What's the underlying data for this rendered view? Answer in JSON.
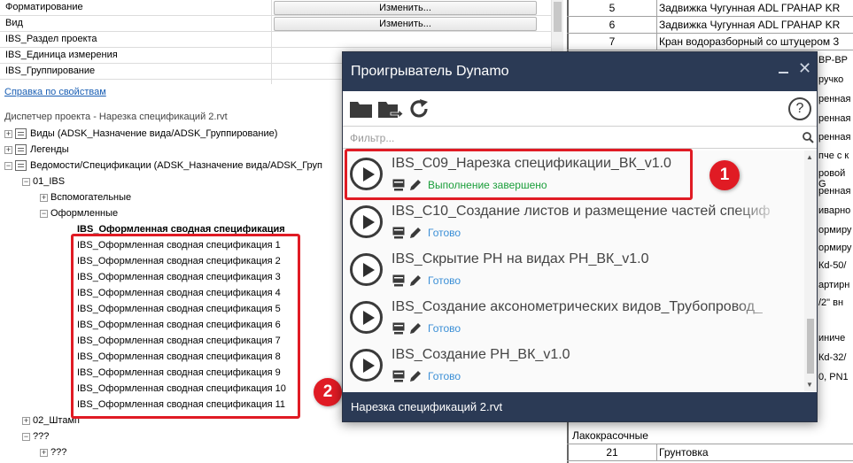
{
  "properties": {
    "rows": [
      {
        "name": "Форматирование",
        "button": "Изменить..."
      },
      {
        "name": "Вид",
        "button": "Изменить..."
      },
      {
        "name": "IBS_Раздел проекта",
        "button": ""
      },
      {
        "name": "IBS_Единица измерения",
        "button": ""
      },
      {
        "name": "IBS_Группирование",
        "button": ""
      }
    ],
    "help_link": "Справка по свойствам"
  },
  "browser": {
    "title": "Диспетчер проекта - Нарезка спецификаций 2.rvt",
    "views": "Виды (ADSK_Назначение вида/ADSK_Группирование)",
    "legends": "Легенды",
    "schedules": "Ведомости/Спецификации (ADSK_Назначение вида/ADSK_Груп",
    "group_01": "01_IBS",
    "aux": "Вспомогательные",
    "formatted": "Оформленные",
    "summary": "IBS_Оформленная сводная спецификация",
    "items": [
      "IBS_Оформленная сводная спецификация 1",
      "IBS_Оформленная сводная спецификация 2",
      "IBS_Оформленная сводная спецификация 3",
      "IBS_Оформленная сводная спецификация 4",
      "IBS_Оформленная сводная спецификация 5",
      "IBS_Оформленная сводная спецификация 6",
      "IBS_Оформленная сводная спецификация 7",
      "IBS_Оформленная сводная спецификация 8",
      "IBS_Оформленная сводная спецификация 9",
      "IBS_Оформленная сводная спецификация 10",
      "IBS_Оформленная сводная спецификация 11"
    ],
    "group_02": "02_Штамп",
    "unknown_1": "???",
    "unknown_2": "???"
  },
  "schedule": {
    "rows": [
      {
        "num": "5",
        "name": "Задвижка Чугунная ADL ГРАНАР KR"
      },
      {
        "num": "6",
        "name": "Задвижка Чугунная ADL ГРАНАР KR"
      },
      {
        "num": "7",
        "name": "Кран водоразборный со штуцером 3"
      }
    ],
    "fragments": [
      "ВР-ВР",
      "ручко",
      "ренная",
      "ренная",
      "ренная",
      "ренная",
      "пче с к",
      "ровой G",
      "ренная",
      "иварно",
      "ормиру",
      "ормиру",
      "Кd-50/",
      "артирн",
      "/2\" вн",
      "иниче",
      "Кd-32/",
      "0, PN1"
    ],
    "section_label": "Лакокрасочные",
    "last_row": {
      "num": "21",
      "name": "Грунтовка"
    }
  },
  "dynamo": {
    "title": "Проигрыватель Dynamo",
    "filter_placeholder": "Фильтр...",
    "scripts": [
      {
        "name": "IBS_C09_Нарезка спецификации_ВК_v1.0",
        "status": "Выполнение завершено",
        "status_color": "#1a9e3a"
      },
      {
        "name": "IBS_C10_Создание листов и размещение частей специф",
        "status": "Готово",
        "status_color": "#3b8fd6"
      },
      {
        "name": "IBS_Скрытие РН на видах РН_ВК_v1.0",
        "status": "Готово",
        "status_color": "#3b8fd6"
      },
      {
        "name": "IBS_Создание аксонометрических видов_Трубопровод_",
        "status": "Готово",
        "status_color": "#3b8fd6"
      },
      {
        "name": "IBS_Создание РН_ВК_v1.0",
        "status": "Готово",
        "status_color": "#3b8fd6"
      }
    ],
    "footer": "Нарезка спецификаций 2.rvt"
  },
  "callouts": {
    "badge_1": "1",
    "badge_2": "2"
  },
  "colors": {
    "accent_red": "#e01b24",
    "header_navy": "#2b3a55"
  }
}
